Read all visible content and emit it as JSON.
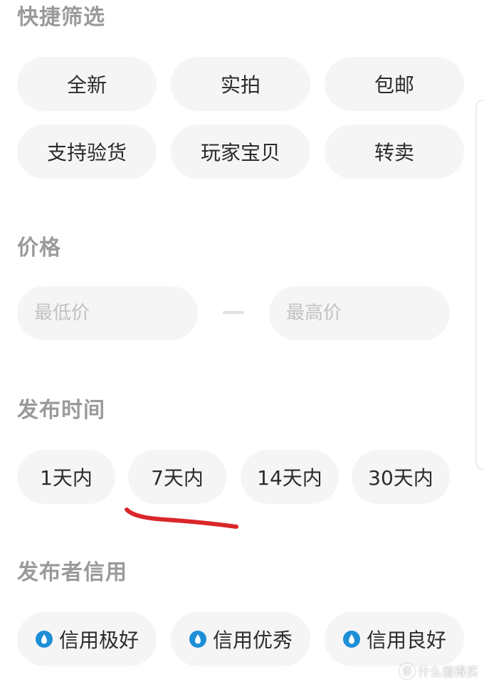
{
  "quick_filter": {
    "title": "快捷筛选",
    "options": [
      "全新",
      "实拍",
      "包邮",
      "支持验货",
      "玩家宝贝",
      "转卖"
    ]
  },
  "price": {
    "title": "价格",
    "min_placeholder": "最低价",
    "max_placeholder": "最高价",
    "separator": "—"
  },
  "publish_time": {
    "title": "发布时间",
    "options": [
      "1天内",
      "7天内",
      "14天内",
      "30天内"
    ]
  },
  "publisher_credit": {
    "title": "发布者信用",
    "options": [
      "信用极好",
      "信用优秀",
      "信用良好"
    ],
    "icon": "credit-drop-icon",
    "icon_color": "#1e8fd6"
  },
  "annotation": {
    "color": "#d9262a",
    "target": "7天内"
  },
  "watermark": {
    "logo": "值",
    "text": "什么值得买"
  }
}
